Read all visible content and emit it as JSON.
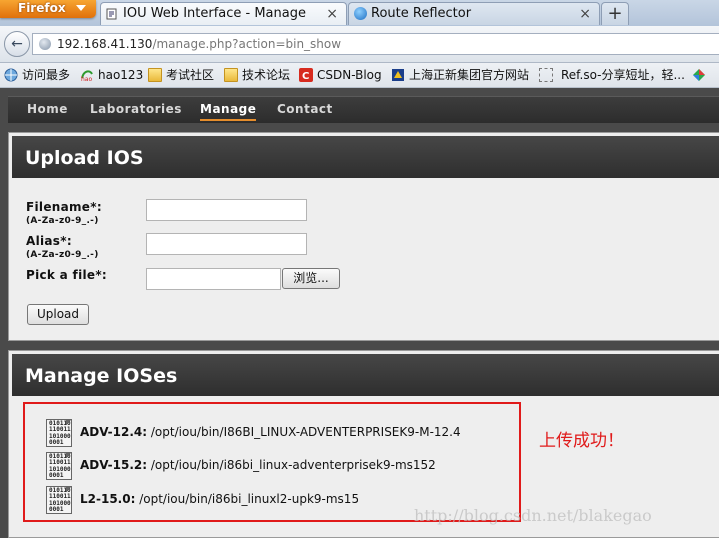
{
  "browser": {
    "app_button": "Firefox",
    "tabs": [
      {
        "label": "IOU Web Interface - Manage",
        "close": "×"
      },
      {
        "label": "Route Reflector",
        "close": "×"
      }
    ],
    "new_tab": "+",
    "back": "←",
    "url_host": "192.168.41.130",
    "url_path": "/manage.php?action=bin_show"
  },
  "bookmarks": [
    {
      "label": "访问最多",
      "icon": "globe-icon"
    },
    {
      "label": "hao123",
      "icon": "hao123-icon"
    },
    {
      "label": "考试社区",
      "icon": "folder-icon"
    },
    {
      "label": "技术论坛",
      "icon": "folder-icon"
    },
    {
      "label": "CSDN-Blog",
      "icon": "csdn-icon"
    },
    {
      "label": "上海正新集团官方网站",
      "icon": "site-icon"
    },
    {
      "label": "Ref.so-分享短址，轻...",
      "icon": "page-icon"
    }
  ],
  "menu": [
    "Home",
    "Laboratories",
    "Manage",
    "Contact"
  ],
  "upload": {
    "title": "Upload IOS",
    "filename_label": "Filename*:",
    "filename_hint": "(A-Za-z0-9_.-)",
    "alias_label": "Alias*:",
    "alias_hint": "(A-Za-z0-9_.-)",
    "file_label": "Pick a file*:",
    "browse_label": "浏览...",
    "upload_label": "Upload"
  },
  "manage": {
    "title": "Manage IOSes",
    "icon_text": "010110\n110011\n101000\n0001",
    "ioses": [
      {
        "name": "ADV-12.4:",
        "path": "/opt/iou/bin/I86BI_LINUX-ADVENTERPRISEK9-M-12.4"
      },
      {
        "name": "ADV-15.2:",
        "path": "/opt/iou/bin/i86bi_linux-adventerprisek9-ms152"
      },
      {
        "name": "L2-15.0:",
        "path": "/opt/iou/bin/i86bi_linuxl2-upk9-ms15"
      }
    ]
  },
  "annotation": "上传成功！",
  "watermark": "http://blog.csdn.net/blakegao",
  "colors": {
    "accent": "#e58d2c",
    "annotation": "#e01a1a",
    "header": "#333333"
  }
}
